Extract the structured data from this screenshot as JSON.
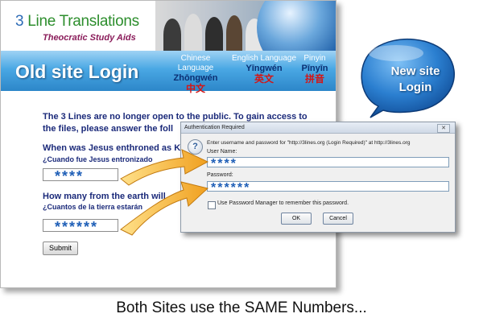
{
  "site": {
    "brand_num": "3",
    "brand_rest": " Line Translations",
    "tagline": "Theocratic Study Aids",
    "banner_title": "Old site Login",
    "languages": [
      {
        "name": "Chinese Language",
        "pinyin": "Zhōngwén",
        "chinese": "中文"
      },
      {
        "name": "English Language",
        "pinyin": "Yīngwén",
        "chinese": "英文"
      },
      {
        "name": "Pinyin",
        "pinyin": "Pīnyīn",
        "chinese": "拼音"
      }
    ],
    "intro": "The 3 Lines are no longer open to the public. To gain access to the files, please answer the foll",
    "q1": "When was Jesus enthroned as K",
    "q1_sub": "¿Cuando fue Jesus entronizado",
    "field1": "****",
    "q2": "How many from the earth will",
    "q2_sub": "¿Cuantos de la tierra estarán",
    "field2": "******",
    "submit": "Submit"
  },
  "dialog": {
    "title": "Authentication Required",
    "close": "✕",
    "icon": "?",
    "prompt": "Enter username and password for \"http://3lines.org (Login Required)\" at http://3lines.org",
    "username_label": "User Name:",
    "username_value": "****",
    "password_label": "Password:",
    "password_value": "******",
    "remember_label": "Use Password Manager to remember this password.",
    "ok": "OK",
    "cancel": "Cancel"
  },
  "bubble": {
    "line1": "New site",
    "line2": "Login"
  },
  "caption": "Both Sites use the SAME Numbers...",
  "colors": {
    "banner": "#3a99d9",
    "question_text": "#1b2a7a",
    "arrow": "#f0a020",
    "bubble": "#1c6fc0"
  }
}
